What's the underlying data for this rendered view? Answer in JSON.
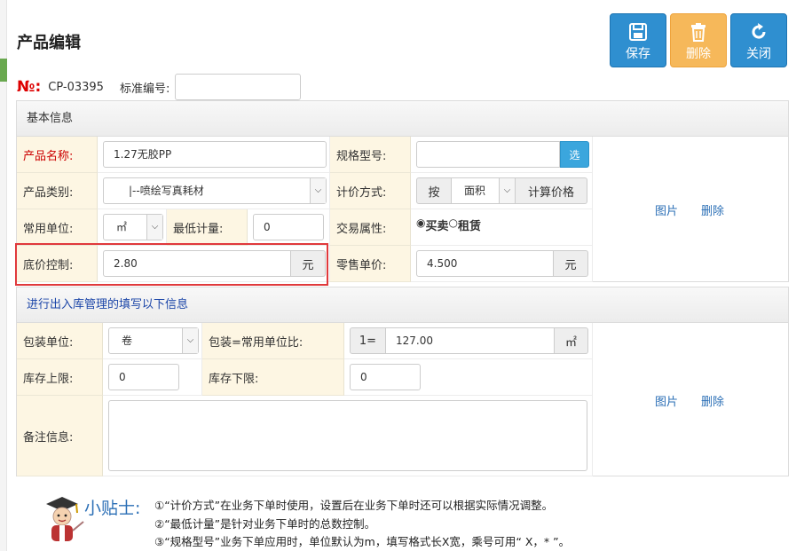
{
  "header": {
    "title": "产品编辑",
    "buttons": {
      "save": "保存",
      "delete": "删除",
      "close": "关闭"
    }
  },
  "record": {
    "no_mark": "№:",
    "code": "CP-03395",
    "std_label": "标准编号:",
    "std_value": ""
  },
  "basic": {
    "heading": "基本信息",
    "name_label": "产品名称:",
    "name_value": "1.27无胶PP",
    "spec_label": "规格型号:",
    "spec_value": "",
    "spec_btn": "选",
    "category_label": "产品类别:",
    "category_value": "|--喷绘写真耗材",
    "pricing_label": "计价方式:",
    "pricing_prefix": "按",
    "pricing_value": "面积",
    "pricing_suffix": "计算价格",
    "unit_label": "常用单位:",
    "unit_value": "㎡",
    "min_label": "最低计量:",
    "min_value": "0",
    "trade_label": "交易属性:",
    "trade_options": [
      "买卖",
      "租赁"
    ],
    "trade_selected": "买卖",
    "floor_label": "底价控制:",
    "floor_value": "2.80",
    "floor_unit": "元",
    "retail_label": "零售单价:",
    "retail_value": "4.500",
    "retail_unit": "元",
    "image_link": "图片",
    "delete_link": "删除"
  },
  "stock": {
    "heading": "进行出入库管理的填写以下信息",
    "pack_label": "包装单位:",
    "pack_value": "卷",
    "ratio_label": "包装=常用单位比:",
    "ratio_prefix": "1=",
    "ratio_value": "127.00",
    "ratio_unit": "㎡",
    "upper_label": "库存上限:",
    "upper_value": "0",
    "lower_label": "库存下限:",
    "lower_value": "0",
    "remark_label": "备注信息:",
    "remark_value": "",
    "image_link": "图片",
    "delete_link": "删除"
  },
  "tips": {
    "title": "小贴士:",
    "lines": [
      "①“计价方式”在业务下单时使用，设置后在业务下单时还可以根据实际情况调整。",
      "②“最低计量”是针对业务下单时的总数控制。",
      "③“规格型号”业务下单应用时，单位默认为m，填写格式长X宽，乘号可用“ X，* ”。"
    ]
  },
  "colors": {
    "primary": "#2f8fd0",
    "warning": "#f6b85a",
    "label_bg": "#fdf6e3",
    "required_label": "#cc0000",
    "highlight_box": "#e0393c",
    "link": "#2b6fb6"
  }
}
